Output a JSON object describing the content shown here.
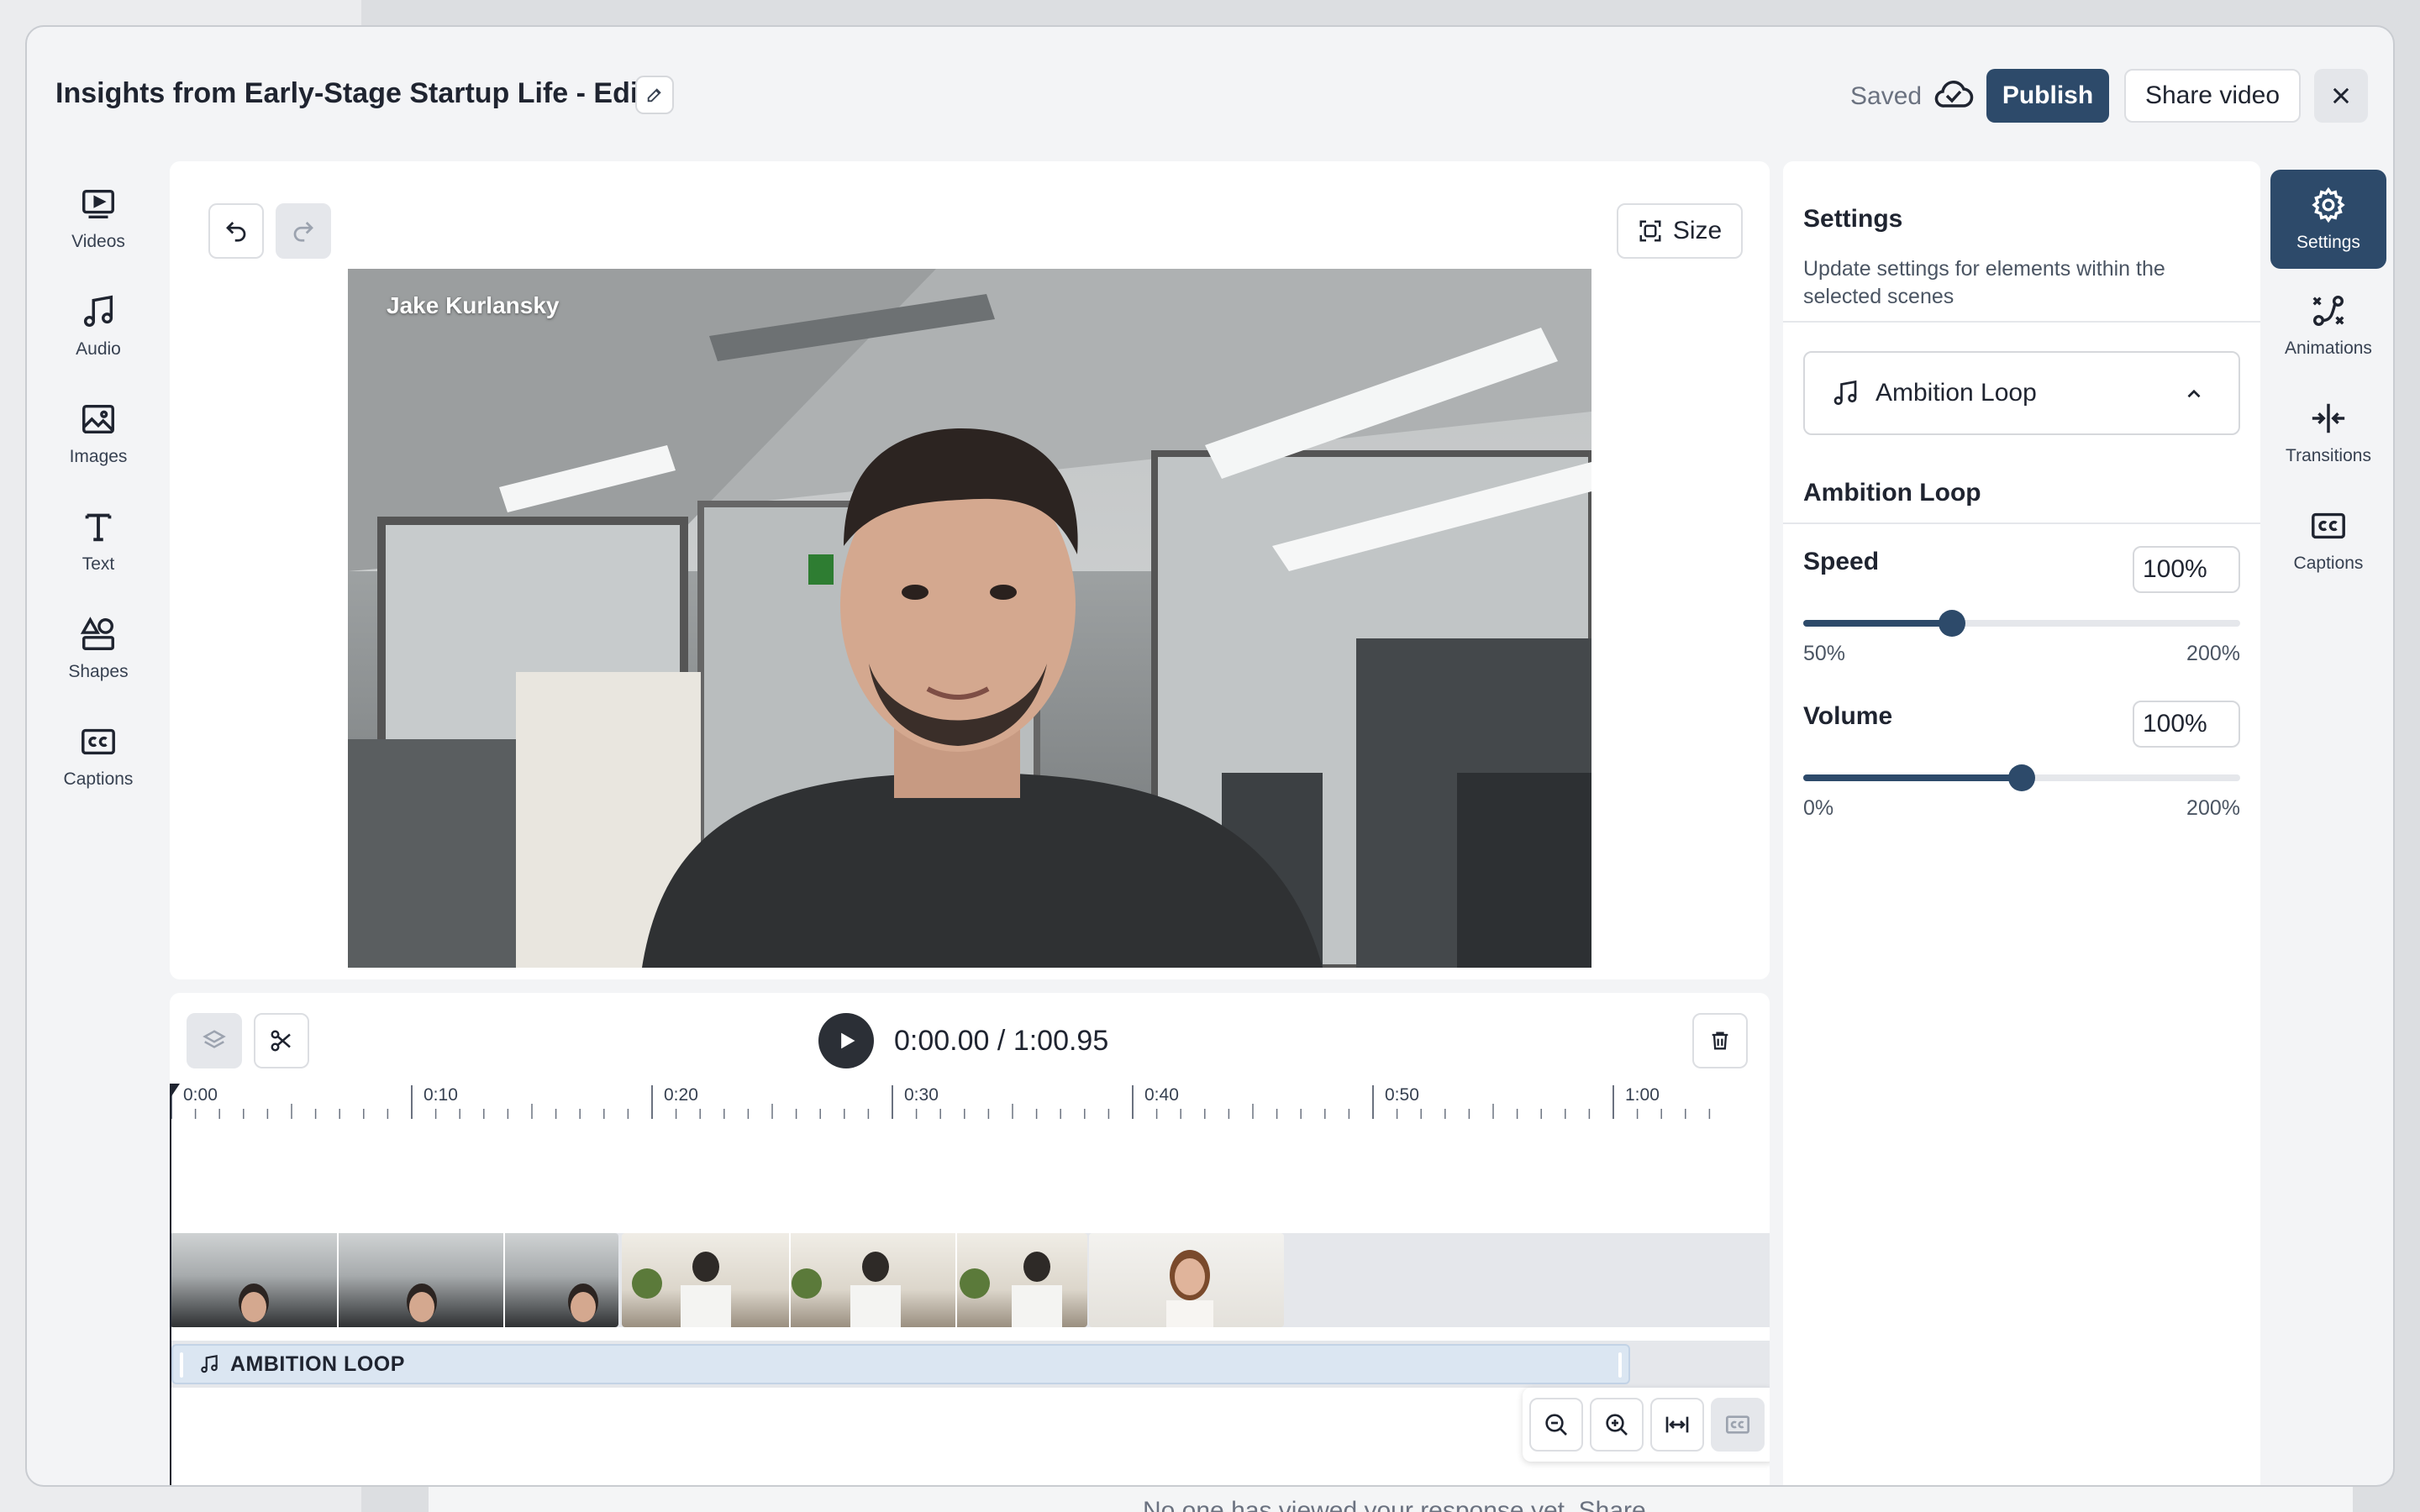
{
  "background": {
    "text": "No one has viewed your response yet. Share"
  },
  "header": {
    "title": "Insights from Early-Stage Startup Life - Edit",
    "saved_label": "Saved",
    "publish_label": "Publish",
    "share_label": "Share video"
  },
  "left_rail": {
    "videos": "Videos",
    "audio": "Audio",
    "images": "Images",
    "text": "Text",
    "shapes": "Shapes",
    "captions": "Captions"
  },
  "right_rail": {
    "settings": "Settings",
    "animations": "Animations",
    "transitions": "Transitions",
    "captions": "Captions"
  },
  "canvas": {
    "size_label": "Size",
    "speaker_name": "Jake Kurlansky"
  },
  "timeline": {
    "current_time": "0:00.00",
    "separator": "/",
    "total_time": "1:00.95",
    "ticks": [
      "0:00",
      "0:10",
      "0:20",
      "0:30",
      "0:40",
      "0:50",
      "1:00"
    ],
    "audio_track_label": "AMBITION LOOP"
  },
  "settings": {
    "title": "Settings",
    "description": "Update settings for elements within the selected scenes",
    "selected_element": "Ambition Loop",
    "section_title": "Ambition Loop",
    "speed": {
      "label": "Speed",
      "value": "100%",
      "min_label": "50%",
      "max_label": "200%",
      "fraction": 0.34
    },
    "volume": {
      "label": "Volume",
      "value": "100%",
      "min_label": "0%",
      "max_label": "200%",
      "fraction": 0.5
    }
  },
  "colors": {
    "accent": "#2d4a6a",
    "audio_clip": "#dbe6f2"
  }
}
